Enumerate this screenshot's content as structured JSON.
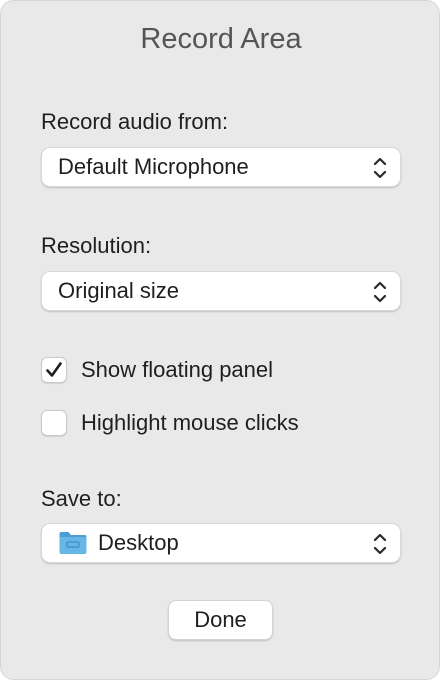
{
  "dialog": {
    "title": "Record Area"
  },
  "audio": {
    "label": "Record audio from:",
    "selected": "Default Microphone"
  },
  "resolution": {
    "label": "Resolution:",
    "selected": "Original size"
  },
  "options": {
    "floating_panel": {
      "label": "Show floating panel",
      "checked": true
    },
    "highlight_clicks": {
      "label": "Highlight mouse clicks",
      "checked": false
    }
  },
  "save": {
    "label": "Save to:",
    "selected": "Desktop",
    "icon": "folder-icon"
  },
  "buttons": {
    "done": "Done"
  },
  "colors": {
    "panel_background": "#e9e9e9",
    "title_text": "#555555",
    "folder_icon": "#5aaee0"
  }
}
